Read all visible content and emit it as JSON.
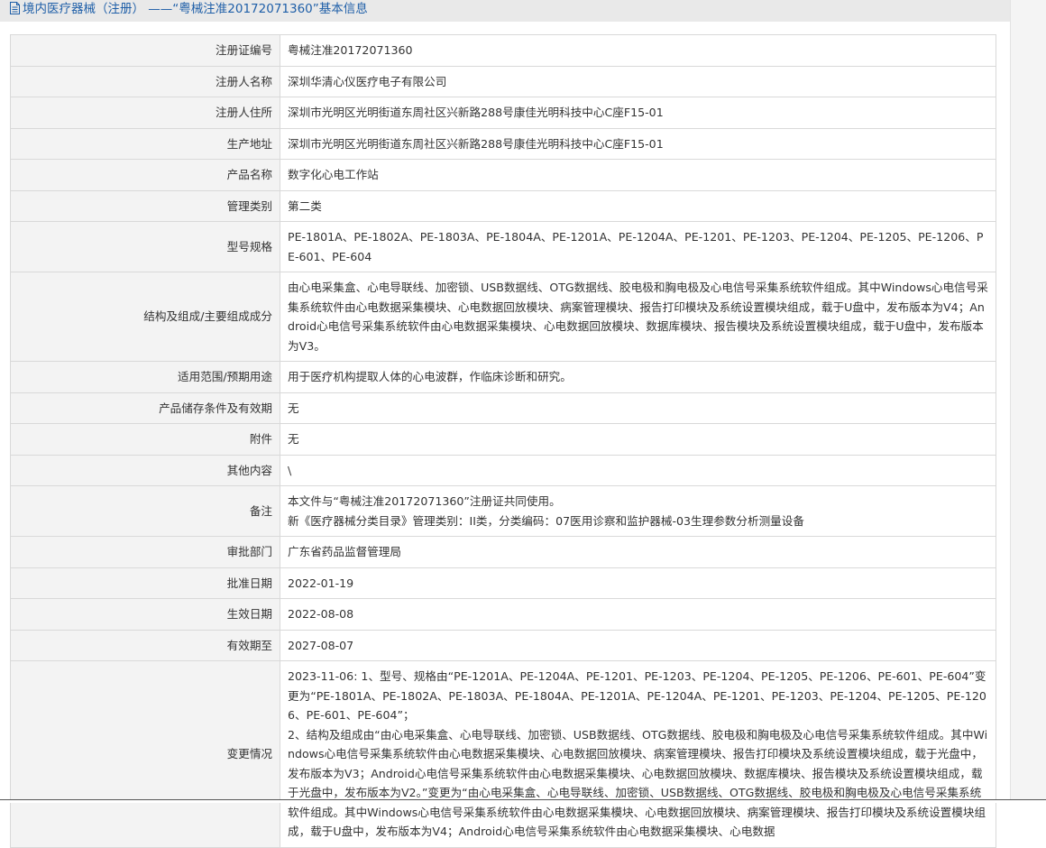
{
  "page": {
    "title": "境内医疗器械（注册） ——“粤械注准20172071360”基本信息",
    "title_icon": "document-icon"
  },
  "rows": [
    {
      "label": "注册证编号",
      "value": "粤械注准20172071360"
    },
    {
      "label": "注册人名称",
      "value": "深圳华清心仪医疗电子有限公司"
    },
    {
      "label": "注册人住所",
      "value": "深圳市光明区光明街道东周社区兴新路288号康佳光明科技中心C座F15-01"
    },
    {
      "label": "生产地址",
      "value": "深圳市光明区光明街道东周社区兴新路288号康佳光明科技中心C座F15-01"
    },
    {
      "label": "产品名称",
      "value": "数字化心电工作站"
    },
    {
      "label": "管理类别",
      "value": "第二类"
    },
    {
      "label": "型号规格",
      "value": "PE-1801A、PE-1802A、PE-1803A、PE-1804A、PE-1201A、PE-1204A、PE-1201、PE-1203、PE-1204、PE-1205、PE-1206、PE-601、PE-604"
    },
    {
      "label": "结构及组成/主要组成成分",
      "value": "由心电采集盒、心电导联线、加密锁、USB数据线、OTG数据线、胶电极和胸电极及心电信号采集系统软件组成。其中Windows心电信号采集系统软件由心电数据采集模块、心电数据回放模块、病案管理模块、报告打印模块及系统设置模块组成，载于U盘中，发布版本为V4；Android心电信号采集系统软件由心电数据采集模块、心电数据回放模块、数据库模块、报告模块及系统设置模块组成，载于U盘中，发布版本为V3。"
    },
    {
      "label": "适用范围/预期用途",
      "value": "用于医疗机构提取人体的心电波群，作临床诊断和研究。"
    },
    {
      "label": "产品储存条件及有效期",
      "value": "无"
    },
    {
      "label": "附件",
      "value": "无"
    },
    {
      "label": "其他内容",
      "value": "\\"
    }
  ],
  "notes": {
    "label": "备注",
    "lines": [
      "本文件与“粤械注准20172071360”注册证共同使用。",
      "新《医疗器械分类目录》管理类别：II类，分类编码：07医用诊察和监护器械-03生理参数分析测量设备"
    ]
  },
  "rows_after": [
    {
      "label": "审批部门",
      "value": "广东省药品监督管理局"
    },
    {
      "label": "批准日期",
      "value": "2022-01-19"
    },
    {
      "label": "生效日期",
      "value": "2022-08-08"
    },
    {
      "label": "有效期至",
      "value": "2027-08-07"
    }
  ],
  "changes": {
    "label": "变更情况",
    "lines": [
      "2023-11-06: 1、型号、规格由“PE-1201A、PE-1204A、PE-1201、PE-1203、PE-1204、PE-1205、PE-1206、PE-601、PE-604”变更为“PE-1801A、PE-1802A、PE-1803A、PE-1804A、PE-1201A、PE-1204A、PE-1201、PE-1203、PE-1204、PE-1205、PE-1206、PE-601、PE-604”；",
      "2、结构及组成由“由心电采集盒、心电导联线、加密锁、USB数据线、OTG数据线、胶电极和胸电极及心电信号采集系统软件组成。其中Windows心电信号采集系统软件由心电数据采集模块、心电数据回放模块、病案管理模块、报告打印模块及系统设置模块组成，载于光盘中，发布版本为V3；Android心电信号采集系统软件由心电数据采集模块、心电数据回放模块、数据库模块、报告模块及系统设置模块组成，载于光盘中，发布版本为V2。”变更为“由心电采集盒、心电导联线、加密锁、USB数据线、OTG数据线、胶电极和胸电极及心电信号采集系统软件组成。其中Windows心电信号采集系统软件由心电数据采集模块、心电数据回放模块、病案管理模块、报告打印模块及系统设置模块组成，载于U盘中，发布版本为V4；Android心电信号采集系统软件由心电数据采集模块、心电数据"
    ]
  },
  "colors": {
    "title_blue": "#1f5fa8",
    "label_bg": "#f3f3f3",
    "border": "#d9d9d9",
    "text": "#333333"
  }
}
